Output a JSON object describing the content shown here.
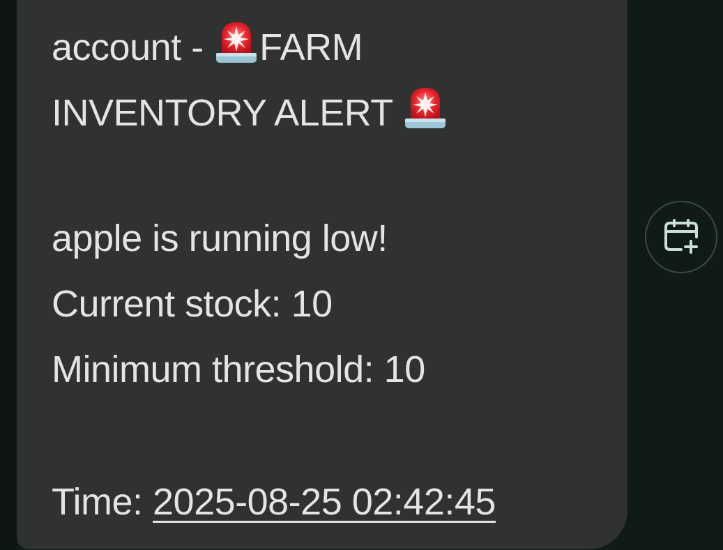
{
  "message": {
    "line1_text": "account - ",
    "line1_suffix": "FARM",
    "line2_text": "INVENTORY ALERT ",
    "line3": "apple is running low!",
    "line4": "Current stock: 10",
    "line5": "Minimum threshold: 10",
    "time_label": "Time: ",
    "time_value": "2025-08-25 02:42:45"
  },
  "icons": {
    "alert": "police-car-light-icon",
    "calendar": "add-to-calendar-icon"
  },
  "colors": {
    "background": "#101a17",
    "bubble": "#303131",
    "text": "#e4e4e4",
    "icon_accent": "#c8e0d6"
  }
}
